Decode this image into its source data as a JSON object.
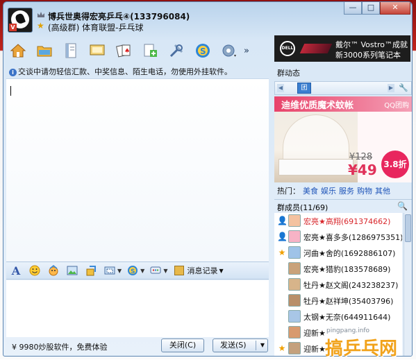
{
  "window": {
    "title": "博兵世奥得宏亮乒乓④(133796084)",
    "subtitle": "(高级群) 体育联盟-乒乓球"
  },
  "window_buttons": [
    "—",
    "□",
    "✕"
  ],
  "toolbar": {
    "more": "»"
  },
  "ad_top": {
    "brand": "DELL",
    "line1": "戴尔™ Vostro™成就",
    "line2": "新3000系列笔记本"
  },
  "notice": "交谈中请勿轻信汇款、中奖信息、陌生电话，勿使用外挂软件。",
  "input_toolbar": {
    "history_label": "消息记录"
  },
  "bottom": {
    "ad_text": "¥ 9980炒股软件，免费体验",
    "close_label": "关闭(C)",
    "send_label": "发送(S)"
  },
  "right_panel": {
    "feed_title": "群动态",
    "promo": {
      "headline": "迪维优质魔术蚊帐",
      "tag": "QQ团购",
      "price_old": "¥128",
      "price_new": "¥49",
      "discount": "3.8折"
    },
    "hot": {
      "label": "热门：",
      "links": [
        "美食",
        "娱乐",
        "服务",
        "购物",
        "其他"
      ]
    },
    "members_title": "群成员(11/69)",
    "members": [
      {
        "name": "宏亮★高翔(691374662)",
        "color": "#d8262b",
        "role": "person"
      },
      {
        "name": "宏亮★喜多多(1286975351)",
        "color": "#111111",
        "role": "person"
      },
      {
        "name": "河曲★舍的(1692886107)",
        "color": "#111111",
        "role": "star"
      },
      {
        "name": "宏亮★猎豹(183578689)",
        "color": "#111111",
        "role": "none"
      },
      {
        "name": "牡丹★赵文阁(243238237)",
        "color": "#111111",
        "role": "none"
      },
      {
        "name": "牡丹★赵祥坤(35403796)",
        "color": "#111111",
        "role": "none"
      },
      {
        "name": "太钢★无奈(644911644)",
        "color": "#111111",
        "role": "none"
      },
      {
        "name": "迎新★",
        "color": "#111111",
        "role": "none"
      },
      {
        "name": "迎新★",
        "color": "#111111",
        "role": "star"
      }
    ]
  },
  "watermark": {
    "url": "pingpang.info",
    "text": "搞乒乓网"
  },
  "colors": {
    "accent": "#3b7fd0",
    "title_bar": "#b9d3ec",
    "link": "#1e54b8",
    "promo": "#e8265e"
  }
}
